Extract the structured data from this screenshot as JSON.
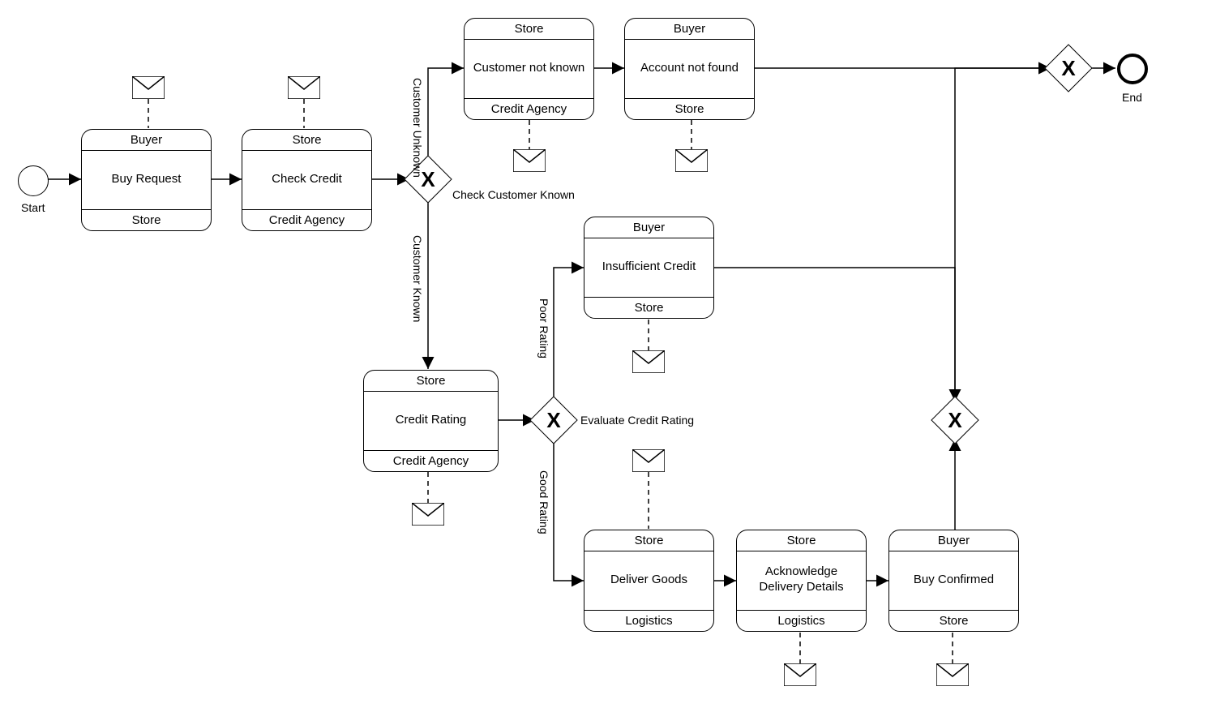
{
  "events": {
    "start": "Start",
    "end": "End"
  },
  "tasks": {
    "buyRequest": {
      "top": "Buyer",
      "mid": "Buy Request",
      "bot": "Store"
    },
    "checkCredit": {
      "top": "Store",
      "mid": "Check Credit",
      "bot": "Credit Agency"
    },
    "custNotKnown": {
      "top": "Store",
      "mid": "Customer not known",
      "bot": "Credit Agency"
    },
    "acctNotFound": {
      "top": "Buyer",
      "mid": "Account not found",
      "bot": "Store"
    },
    "creditRating": {
      "top": "Store",
      "mid": "Credit Rating",
      "bot": "Credit Agency"
    },
    "insufCredit": {
      "top": "Buyer",
      "mid": "Insufficient Credit",
      "bot": "Store"
    },
    "deliverGoods": {
      "top": "Store",
      "mid": "Deliver Goods",
      "bot": "Logistics"
    },
    "ackDelivery": {
      "top": "Store",
      "mid": "Acknowledge Delivery Details",
      "bot": "Logistics"
    },
    "buyConfirmed": {
      "top": "Buyer",
      "mid": "Buy Confirmed",
      "bot": "Store"
    }
  },
  "gateways": {
    "g1": "Check Customer Known",
    "g2": "Evaluate Credit Rating"
  },
  "edgeLabels": {
    "custUnknown": "Customer Unknown",
    "custKnown": "Customer Known",
    "poorRating": "Poor Rating",
    "goodRating": "Good Rating"
  }
}
